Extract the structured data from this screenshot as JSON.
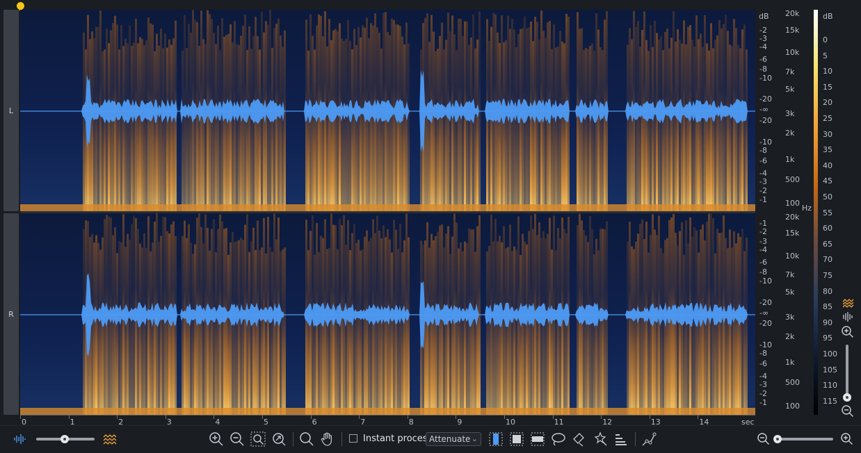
{
  "channels": {
    "left": "L",
    "right": "R"
  },
  "freq_axis": {
    "unit_label": "Hz",
    "top_labels": [
      "20k",
      "15k",
      "10k",
      "7k",
      "5k",
      "3k",
      "2k",
      "1k",
      "500",
      "100"
    ],
    "bottom_labels": [
      "20k",
      "15k",
      "10k",
      "7k",
      "5k",
      "3k",
      "2k",
      "1k",
      "500",
      "100"
    ]
  },
  "db_axis": {
    "unit_label": "dB",
    "upper_labels": [
      "-2",
      "-3",
      "-4",
      "-6",
      "-8",
      "-10",
      "-20",
      "-∞",
      "-20",
      "-10",
      "-8",
      "-6",
      "-4",
      "-3",
      "-2",
      "-1"
    ],
    "lower_labels": [
      "-1",
      "-2",
      "-3",
      "-4",
      "-6",
      "-8",
      "-10",
      "-20",
      "-∞",
      "-20",
      "-10",
      "-8",
      "-6",
      "-4",
      "-3",
      "-2",
      "-1"
    ]
  },
  "colorbar": {
    "unit_label": "dB",
    "labels": [
      "0",
      "5",
      "10",
      "15",
      "20",
      "25",
      "30",
      "35",
      "40",
      "45",
      "50",
      "55",
      "60",
      "65",
      "70",
      "75",
      "80",
      "85",
      "90",
      "95",
      "100",
      "105",
      "110",
      "115"
    ],
    "gradient": [
      "#ffffff",
      "#f6e26a",
      "#f2a23a",
      "#c86a16",
      "#6b4a3e",
      "#2b3b5c",
      "#0f1a33",
      "#000000"
    ]
  },
  "time_axis": {
    "labels": [
      "0",
      "1",
      "2",
      "3",
      "4",
      "5",
      "6",
      "7",
      "8",
      "9",
      "10",
      "11",
      "12",
      "13",
      "14"
    ],
    "unit": "sec"
  },
  "toolbar": {
    "instant_process_label": "Instant process",
    "instant_process_checked": false,
    "mode_value": "Attenuate"
  },
  "colors": {
    "waveform": "#4d9bf5",
    "spectro_low": "#0d1f45",
    "spectro_high": "#f4a63c",
    "playhead": "#f5c518",
    "accent": "#f0a43a"
  }
}
